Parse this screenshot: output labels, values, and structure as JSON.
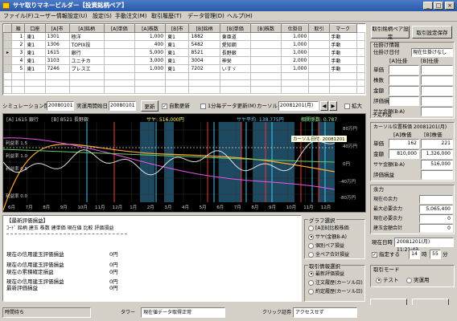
{
  "window": {
    "title": "サヤ取りマネービルダー【投資銘柄ペア】"
  },
  "menu": [
    "ファイル(F)",
    "ユーザー情報設定(U)",
    "設定(S)",
    "手動注文(M)",
    "取引履歴(T)",
    "データ管理(D)",
    "ヘルプ(H)"
  ],
  "toolbar": {
    "pair_setting": "取引銘柄ペア設定",
    "pair_save": "取引設定保存"
  },
  "pairs_table": {
    "headers": [
      "順",
      "口座",
      "[A]市",
      "[A]銘柄",
      "[A]単価",
      "[A]株数",
      "[B]市",
      "[B]銘柄",
      "[B]単価",
      "[B]株数",
      "仕掛日",
      "取引",
      "マーク"
    ],
    "rows": [
      {
        "no": "1",
        "acct": "東1",
        "a_code": "1301",
        "a_name": "極洋",
        "a_price": "",
        "a_qty": "1,000",
        "b_acct": "東1",
        "b_code": "1882",
        "b_name": "東亜道",
        "b_price": "",
        "b_qty": "1,000",
        "date": "",
        "mode": "手動",
        "mark": ""
      },
      {
        "no": "2",
        "acct": "東1",
        "a_code": "1306",
        "a_name": "TOPIX投",
        "a_price": "",
        "a_qty": "400",
        "b_acct": "東1",
        "b_code": "5482",
        "b_name": "愛知鋼",
        "b_price": "",
        "b_qty": "1,000",
        "date": "",
        "mode": "手動",
        "mark": ""
      },
      {
        "no": "3",
        "acct": "東1",
        "a_code": "1615",
        "a_name": "銀行",
        "a_price": "",
        "a_qty": "5,000",
        "b_acct": "東1",
        "b_code": "8521",
        "b_name": "長野銀",
        "b_price": "",
        "b_qty": "1,000",
        "date": "",
        "mode": "手動",
        "mark": ""
      },
      {
        "no": "4",
        "acct": "東1",
        "a_code": "3103",
        "a_name": "ユニチカ",
        "a_price": "",
        "a_qty": "3,000",
        "b_acct": "東1",
        "b_code": "3004",
        "b_name": "神栄",
        "b_price": "",
        "b_qty": "2,000",
        "date": "",
        "mode": "手動",
        "mark": ""
      },
      {
        "no": "5",
        "acct": "東1",
        "a_code": "7246",
        "a_name": "プレスエ",
        "a_price": "",
        "a_qty": "1,000",
        "b_acct": "東1",
        "b_code": "7202",
        "b_name": "いすゞ",
        "b_price": "",
        "b_qty": "1,000",
        "date": "",
        "mode": "手動",
        "mark": ""
      }
    ]
  },
  "sim": {
    "start_label": "シミュレーション開始日",
    "start_value": "20080101",
    "run_label": "実運用開始日",
    "run_value": "20080101",
    "update": "更新",
    "auto_update": "自動更新",
    "per_minute": "1分毎データ更新(M)",
    "cursor_label": "カーソル",
    "cursor_value": "20081201(月)",
    "zoom": "拡大"
  },
  "chart": {
    "legend_a": "[A] 1615 銀行",
    "legend_b": "[B] 8521 長野銀",
    "legend_c1": "サヤ: 516,000円",
    "legend_c2": "サヤ平均: 138,775円",
    "legend_c3": "相関係数: 0.787",
    "left_labels": [
      "利益率 1.5",
      "利益率 1.0",
      "利益率 0.5",
      "利益率 0.0"
    ],
    "right_labels": [
      "80万円",
      "40万円",
      "0円",
      "-40万円",
      "-80万円"
    ],
    "months": [
      "6月",
      "7月",
      "8月",
      "9月",
      "10月",
      "11月",
      "12月",
      "1月",
      "2月",
      "3月",
      "4月",
      "5月",
      "6月",
      "7月",
      "8月",
      "9月",
      "10月",
      "11月",
      "12月"
    ],
    "tooltip": "カーソル日付: 20081201"
  },
  "report": {
    "title": "【最新評価損益】",
    "header": "ｺｰﾄﾞ  銘柄     建玉   株数   建単価   現在値   比較   評価損益",
    "lines": [
      {
        "label": "現在の信用建玉評価損益",
        "value": "0円"
      },
      {
        "label": "現在の信用建玉評価損益",
        "value": "0円"
      },
      {
        "label": "現在の累積確定損益",
        "value": "0円"
      },
      {
        "label": "現在の信用建玉評価損益",
        "value": "0円"
      },
      {
        "label": "最新評価損益",
        "value": "0円"
      }
    ]
  },
  "graph_select": {
    "title": "グラフ選択",
    "options": [
      "[A][B]比較株価",
      "サヤ(金額B-A)",
      "個別ペア損益",
      "全ペア合計損益"
    ],
    "selected": 1
  },
  "trade_info": {
    "title": "取引情報選択",
    "options": [
      "最新評価損益",
      "注文履歴(カーソル日)",
      "約定履歴(カーソル日)"
    ],
    "selected": 0
  },
  "right_panel": {
    "entry_title": "仕掛け情報",
    "entry_date_label": "仕掛け日付",
    "entry_status": "現在仕掛けなし",
    "col_a": "[A]仕掛",
    "col_b": "[B]仕掛",
    "rows": [
      "単価",
      "株数",
      "金額",
      "評価損益"
    ],
    "spread_label": "サヤ金額(B-A)",
    "planned_profit": "予定利益",
    "cursor_title": "カーソル位置株価",
    "cursor_date": "20081201(月)",
    "ca_label": "[A]株価",
    "cb_label": "[B]株価",
    "c_price_label": "単価",
    "c_price_a": "162",
    "c_price_b": "221",
    "c_amount_label": "金額",
    "c_amount_a": "810,000",
    "c_amount_b": "1,326,000",
    "c_spread_label": "サヤ金額(B-A)",
    "c_spread": "516,000",
    "c_eval_label": "評価損益",
    "margin_title": "余力",
    "margin_rows": [
      {
        "label": "現在の余力",
        "value": ""
      },
      {
        "label": "最大必要余力",
        "value": "5,065,400"
      },
      {
        "label": "現在必要余力",
        "value": "0"
      },
      {
        "label": "建玉金額合計",
        "value": "0"
      }
    ],
    "now_label": "現在日時",
    "now_value": "20081201(月) 11:21:43",
    "stop_label": "指定する",
    "stop_hour": "14",
    "stop_hour_unit": "時",
    "stop_min": "55",
    "stop_min_unit": "分",
    "mode_title": "取引モード",
    "mode_test": "テスト",
    "mode_live": "実運用",
    "start_btn": "取引開始",
    "stop_btn": "取引終了"
  },
  "status": {
    "time_label": "時間待ち",
    "timer_label": "タワー",
    "timer_value": "現在値データ取得正常",
    "click_label": "クリック証券",
    "click_value": "アクセスせず"
  }
}
